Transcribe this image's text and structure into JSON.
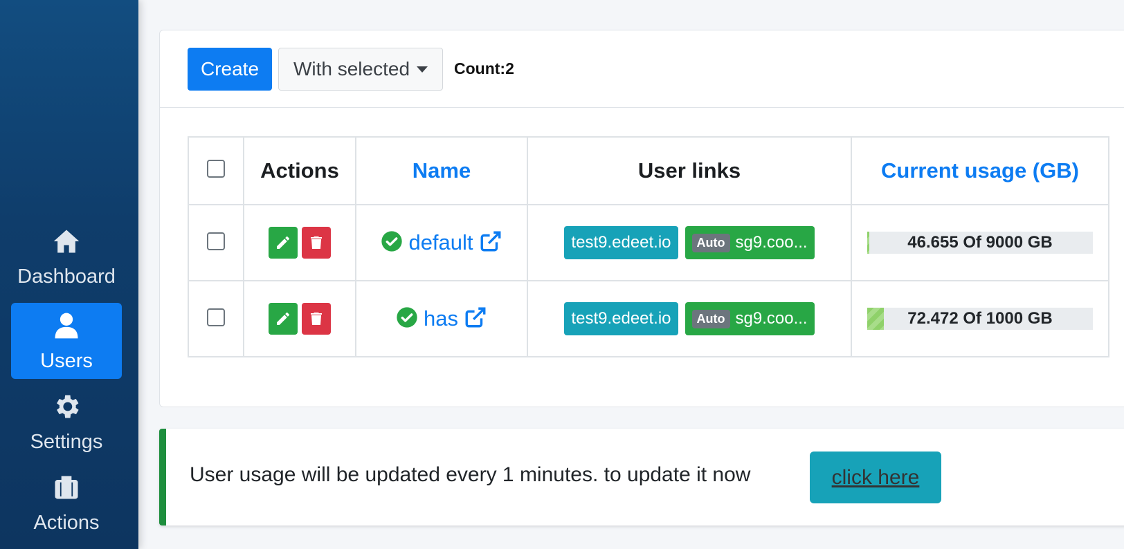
{
  "sidebar": {
    "items": [
      {
        "label": "Dashboard",
        "icon": "home-icon"
      },
      {
        "label": "Users",
        "icon": "user-icon",
        "active": true
      },
      {
        "label": "Settings",
        "icon": "gear-icon"
      },
      {
        "label": "Actions",
        "icon": "briefcase-icon"
      }
    ]
  },
  "toolbar": {
    "create_label": "Create",
    "with_selected_label": "With selected",
    "count_label": "Count:2"
  },
  "table": {
    "headers": [
      "Actions",
      "Name",
      "User links",
      "Current usage (GB)"
    ],
    "rows": [
      {
        "name": "default",
        "link1": "test9.edeet.io",
        "auto_tag": "Auto",
        "link2": "sg9.coo...",
        "usage_text": "46.655 Of 9000 GB",
        "usage_fraction": 0.0052
      },
      {
        "name": "has",
        "link1": "test9.edeet.io",
        "auto_tag": "Auto",
        "link2": "sg9.coo...",
        "usage_text": "72.472 Of 1000 GB",
        "usage_fraction": 0.0725
      }
    ]
  },
  "alert": {
    "text": "User usage will be updated every 1 minutes. to update it now",
    "button_label": "click here"
  },
  "colors": {
    "primary": "#0d7cf2",
    "success": "#28a745",
    "danger": "#dc3545",
    "info": "#17a2b8",
    "sidebar": "#124d80"
  }
}
